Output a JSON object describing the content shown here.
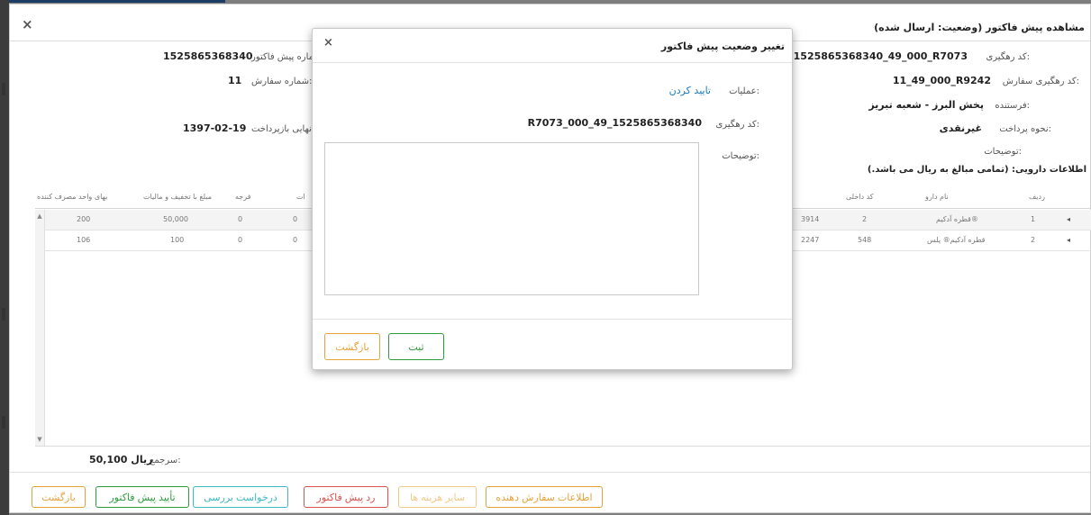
{
  "window": {
    "title": "مشاهده پیش فاکتور (وضعیت: ارسال شده)",
    "close_glyph": "×"
  },
  "info": {
    "tracking_code_label": "کد رهگیری:",
    "tracking_code_value": "1525865368340_49_000_R7073",
    "order_tracking_label": "کد رهگیری سفارش:",
    "order_tracking_value": "11_49_000_R9242",
    "sender_label": "فرستنده:",
    "sender_value": "پخش البرز - شعبه تبریز",
    "payment_label": "نحوه پرداخت:",
    "payment_value": "غیرنقدی",
    "desc_label": "توضیحات:",
    "drug_info": "اطلاعات دارویی: (تمامی مبالغ به ریال می باشد.)",
    "invoice_number_label": "ماره پیش فاکتور:",
    "invoice_number_value": "1525865368340",
    "order_number_label": "شماره سفارش:",
    "order_number_value": "11",
    "repayment_label": "نهایی بازپرداخت:",
    "repayment_value": "1397-02-19"
  },
  "table": {
    "headers": [
      "ردیف",
      "نام دارو",
      "کد داخلی",
      "فرجه",
      "مبلغ با تخفیف و مالیات",
      "بهای واحد مصرف کننده",
      "ات"
    ],
    "rows": [
      {
        "index": "1",
        "name": "قطره آدکیم®",
        "internal_code": "2",
        "code_fragment": "3914",
        "col_fragment": "0",
        "farjeh": "0",
        "amount": "50,000",
        "unit_price": "200"
      },
      {
        "index": "2",
        "name": "قطره آدکیم® پلس",
        "internal_code": "548",
        "code_fragment": "2247",
        "col_fragment": "0",
        "farjeh": "0",
        "amount": "100",
        "unit_price": "106"
      }
    ],
    "expand_glyph": "◂"
  },
  "totals": {
    "label": "سرجمع:",
    "value": "50,100 ریال"
  },
  "footer_buttons": {
    "supplier_info": "اطلاعات سفارش دهنده",
    "other_costs": "سایر هزینه ها",
    "reject": "رد پیش فاکتور",
    "review_request": "درخواست بررسی",
    "confirm": "تأیید پیش فاکتور",
    "back": "بازگشت"
  },
  "modal": {
    "title": "تغییر وضعیت پیش فاکتور",
    "close_glyph": "×",
    "operation_label": "عملیات:",
    "operation_value": "تایید کردن",
    "tracking_label": "کد رهگیری:",
    "tracking_value": "R7073_000_49_1525865368340",
    "desc_label": "توضیحات:",
    "desc_value": "",
    "submit": "ثبت",
    "back": "بازگشت"
  },
  "colors": {
    "accent_blue": "#1a7bc4",
    "green": "#2e9a3c",
    "red": "#d9534f",
    "orange": "#e6a23c",
    "teal": "#3fb8c4",
    "muted_orange": "#f0c98a"
  }
}
